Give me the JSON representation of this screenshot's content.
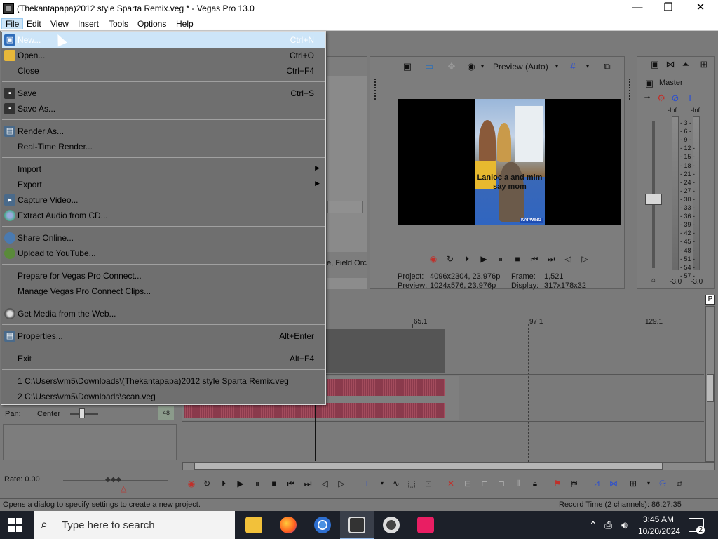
{
  "window": {
    "title": "(Thekantapapa)2012 style Sparta Remix.veg * - Vegas Pro 13.0",
    "minimize": "—",
    "maximize": "❐",
    "close": "✕"
  },
  "menubar": [
    "File",
    "Edit",
    "View",
    "Insert",
    "Tools",
    "Options",
    "Help"
  ],
  "file_menu": {
    "new": {
      "label": "New...",
      "shortcut": "Ctrl+N"
    },
    "open": {
      "label": "Open...",
      "shortcut": "Ctrl+O"
    },
    "close": {
      "label": "Close",
      "shortcut": "Ctrl+F4"
    },
    "save": {
      "label": "Save",
      "shortcut": "Ctrl+S"
    },
    "save_as": {
      "label": "Save As..."
    },
    "render_as": {
      "label": "Render As..."
    },
    "realtime_render": {
      "label": "Real-Time Render..."
    },
    "import": {
      "label": "Import"
    },
    "export": {
      "label": "Export"
    },
    "capture_video": {
      "label": "Capture Video..."
    },
    "extract_audio": {
      "label": "Extract Audio from CD..."
    },
    "share_online": {
      "label": "Share Online..."
    },
    "upload_youtube": {
      "label": "Upload to YouTube..."
    },
    "prepare_connect": {
      "label": "Prepare for Vegas Pro Connect..."
    },
    "manage_connect": {
      "label": "Manage Vegas Pro Connect Clips..."
    },
    "get_media": {
      "label": "Get Media from the Web..."
    },
    "properties": {
      "label": "Properties...",
      "shortcut": "Alt+Enter"
    },
    "exit": {
      "label": "Exit",
      "shortcut": "Alt+F4"
    },
    "recent1": "1 C:\\Users\\vm5\\Downloads\\(Thekantapapa)2012 style Sparta Remix.veg",
    "recent2": "2 C:\\Users\\vm5\\Downloads\\scan.veg"
  },
  "preview": {
    "quality": "Preview (Auto)",
    "project_label": "Project:",
    "project_value": "4096x2304, 23.976p",
    "preview_label": "Preview:",
    "preview_value": "1024x576, 23.976p",
    "frame_label": "Frame:",
    "frame_value": "1,521",
    "display_label": "Display:",
    "display_value": "317x178x32",
    "image_caption": "Lanloc a and mim say mom",
    "watermark": "KAPWING"
  },
  "mixer": {
    "title": "Master",
    "left_peak": "-Inf.",
    "right_peak": "-Inf.",
    "scale": [
      "3",
      "6",
      "9",
      "12",
      "15",
      "18",
      "21",
      "24",
      "27",
      "30",
      "33",
      "36",
      "39",
      "42",
      "45",
      "48",
      "51",
      "54",
      "57"
    ],
    "left_bottom": "-3.0",
    "right_bottom": "-3.0"
  },
  "timeline": {
    "markers": [
      "65.1",
      "97.1",
      "129.1"
    ],
    "field_order_text": "e, Field Orc",
    "pan_label": "Pan:",
    "pan_value": "Center",
    "rate_label": "Rate: 0.00",
    "track_level": "48"
  },
  "status": {
    "hint": "Opens a dialog to specify settings to create a new project.",
    "record_time": "Record Time (2 channels): 86:27:35"
  },
  "taskbar": {
    "search_placeholder": "Type here to search",
    "time": "3:45 AM",
    "date": "10/20/2024",
    "notifications": "2"
  }
}
